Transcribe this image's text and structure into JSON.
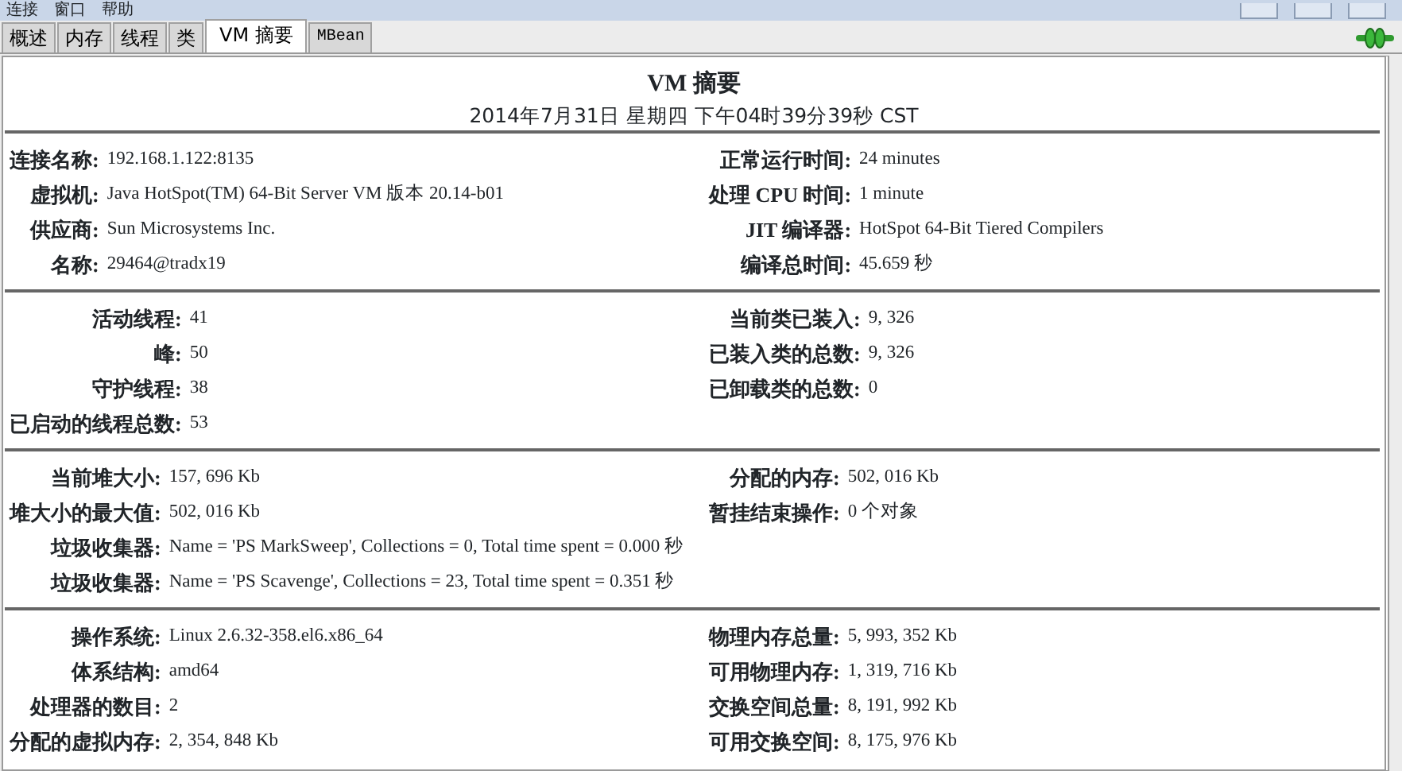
{
  "menu": [
    "连接",
    "窗口",
    "帮助"
  ],
  "tabs": [
    {
      "label": "概述",
      "selected": false
    },
    {
      "label": "内存",
      "selected": false
    },
    {
      "label": "线程",
      "selected": false
    },
    {
      "label": "类",
      "selected": false
    },
    {
      "label": "VM 摘要",
      "selected": true
    },
    {
      "label": "MBean",
      "selected": false
    }
  ],
  "header": {
    "title": "VM 摘要",
    "timestamp": "2014年7月31日 星期四 下午04时39分39秒 CST"
  },
  "sections": [
    {
      "left": [
        {
          "label": "连接名称:",
          "value": "192.168.1.122:8135"
        },
        {
          "label": "虚拟机:",
          "value": "Java HotSpot(TM) 64-Bit Server VM 版本 20.14-b01"
        },
        {
          "label": "供应商:",
          "value": "Sun Microsystems Inc."
        },
        {
          "label": "名称:",
          "value": "29464@tradx19"
        }
      ],
      "right": [
        {
          "label": "正常运行时间:",
          "value": "24 minutes"
        },
        {
          "label": "处理 CPU 时间:",
          "value": "1 minute"
        },
        {
          "label": "JIT 编译器:",
          "value": "HotSpot 64-Bit Tiered Compilers"
        },
        {
          "label": "编译总时间:",
          "value": "45.659 秒"
        }
      ]
    },
    {
      "left": [
        {
          "label": "活动线程:",
          "value": "41"
        },
        {
          "label": "峰:",
          "value": "50"
        },
        {
          "label": "守护线程:",
          "value": "38"
        },
        {
          "label": "已启动的线程总数:",
          "value": "53"
        }
      ],
      "right": [
        {
          "label": "当前类已装入:",
          "value": "9, 326"
        },
        {
          "label": "已装入类的总数:",
          "value": "9, 326"
        },
        {
          "label": "已卸载类的总数:",
          "value": "0"
        }
      ]
    },
    {
      "left": [
        {
          "label": "当前堆大小:",
          "value": "157, 696 Kb"
        },
        {
          "label": "堆大小的最大值:",
          "value": "502, 016 Kb"
        },
        {
          "label": "垃圾收集器:",
          "value": "Name = 'PS MarkSweep', Collections = 0, Total time spent = 0.000 秒"
        },
        {
          "label": "垃圾收集器:",
          "value": "Name = 'PS Scavenge', Collections = 23, Total time spent = 0.351 秒"
        }
      ],
      "right": [
        {
          "label": "分配的内存:",
          "value": "502, 016 Kb"
        },
        {
          "label": "暂挂结束操作:",
          "value": "0 个对象"
        }
      ]
    },
    {
      "left": [
        {
          "label": "操作系统:",
          "value": "Linux 2.6.32-358.el6.x86_64"
        },
        {
          "label": "体系结构:",
          "value": "amd64"
        },
        {
          "label": "处理器的数目:",
          "value": "2"
        },
        {
          "label": "分配的虚拟内存:",
          "value": "2, 354, 848 Kb"
        }
      ],
      "right": [
        {
          "label": "物理内存总量:",
          "value": "5, 993, 352 Kb"
        },
        {
          "label": "可用物理内存:",
          "value": "1, 319, 716 Kb"
        },
        {
          "label": "交换空间总量:",
          "value": "8, 191, 992 Kb"
        },
        {
          "label": "可用交换空间:",
          "value": "8, 175, 976 Kb"
        }
      ]
    }
  ]
}
